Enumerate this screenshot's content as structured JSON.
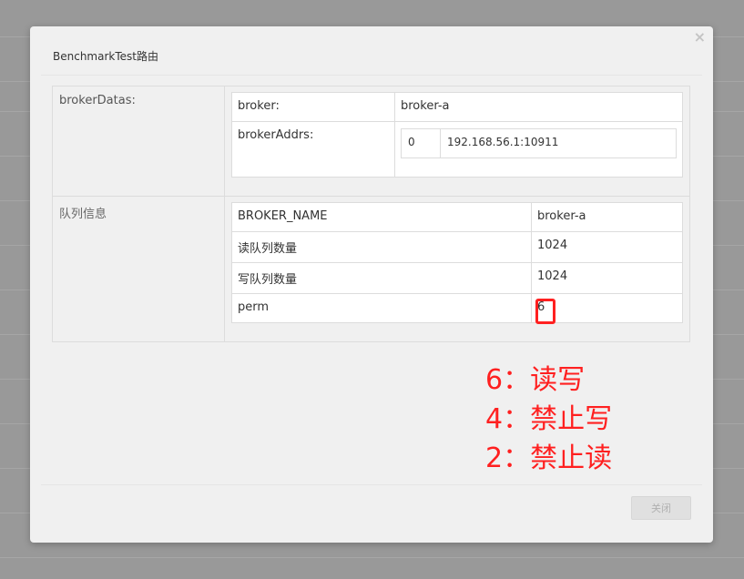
{
  "modal": {
    "title": "BenchmarkTest路由",
    "close_symbol": "×",
    "close_button_label": "关闭"
  },
  "broker_datas": {
    "label": "brokerDatas:",
    "broker_label": "broker:",
    "broker_value": "broker-a",
    "addrs_label": "brokerAddrs:",
    "addrs": [
      {
        "index": "0",
        "address": "192.168.56.1:10911"
      }
    ]
  },
  "queue_info": {
    "label": "队列信息",
    "rows": [
      {
        "key": "BROKER_NAME",
        "value": "broker-a"
      },
      {
        "key": "读队列数量",
        "value": "1024"
      },
      {
        "key": "写队列数量",
        "value": "1024"
      },
      {
        "key": "perm",
        "value": "6"
      }
    ]
  },
  "annotations": [
    "6：读写",
    "4：禁止写",
    "2：禁止读"
  ],
  "colors": {
    "annotation": "#ff2020",
    "overlay": "#999999",
    "modal_bg": "#f0f0f0"
  }
}
